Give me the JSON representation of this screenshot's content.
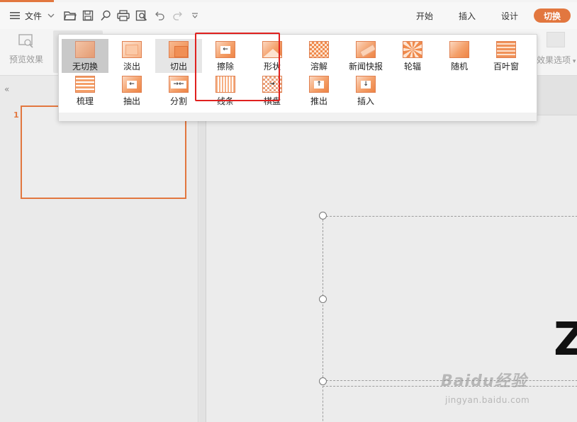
{
  "menu": {
    "file_label": "文件",
    "icons": [
      "hamburger-icon",
      "chevron-down-icon",
      "open-folder-icon",
      "save-icon",
      "find-icon",
      "print-icon",
      "print-preview-icon",
      "undo-icon",
      "redo-icon",
      "customize-toolbar-icon"
    ]
  },
  "tabs": [
    {
      "label": "开始"
    },
    {
      "label": "插入"
    },
    {
      "label": "设计"
    },
    {
      "label": "切换",
      "active": true
    }
  ],
  "ribbon": {
    "preview_label": "预览效果",
    "effect_options_label": "效果选项"
  },
  "transition_gallery": {
    "row1": [
      {
        "label": "无切换",
        "state": "selected"
      },
      {
        "label": "淡出"
      },
      {
        "label": "切出",
        "state": "hover"
      },
      {
        "label": "擦除"
      },
      {
        "label": "形状"
      },
      {
        "label": "溶解"
      },
      {
        "label": "新闻快报"
      },
      {
        "label": "轮辐"
      },
      {
        "label": "随机"
      },
      {
        "label": "百叶窗"
      }
    ],
    "row2": [
      {
        "label": "梳理"
      },
      {
        "label": "抽出"
      },
      {
        "label": "分割"
      },
      {
        "label": "线条"
      },
      {
        "label": "棋盘"
      },
      {
        "label": "推出"
      },
      {
        "label": "插入"
      }
    ]
  },
  "slides_panel": {
    "collapse_glyph": "«",
    "slide_number": "1"
  },
  "canvas": {
    "visible_glyph": "Z"
  },
  "watermark": {
    "line1": "Baidu经验",
    "line2": "jingyan.baidu.com"
  },
  "colors": {
    "accent": "#e2773f",
    "annotation_box": "#e0211f"
  }
}
